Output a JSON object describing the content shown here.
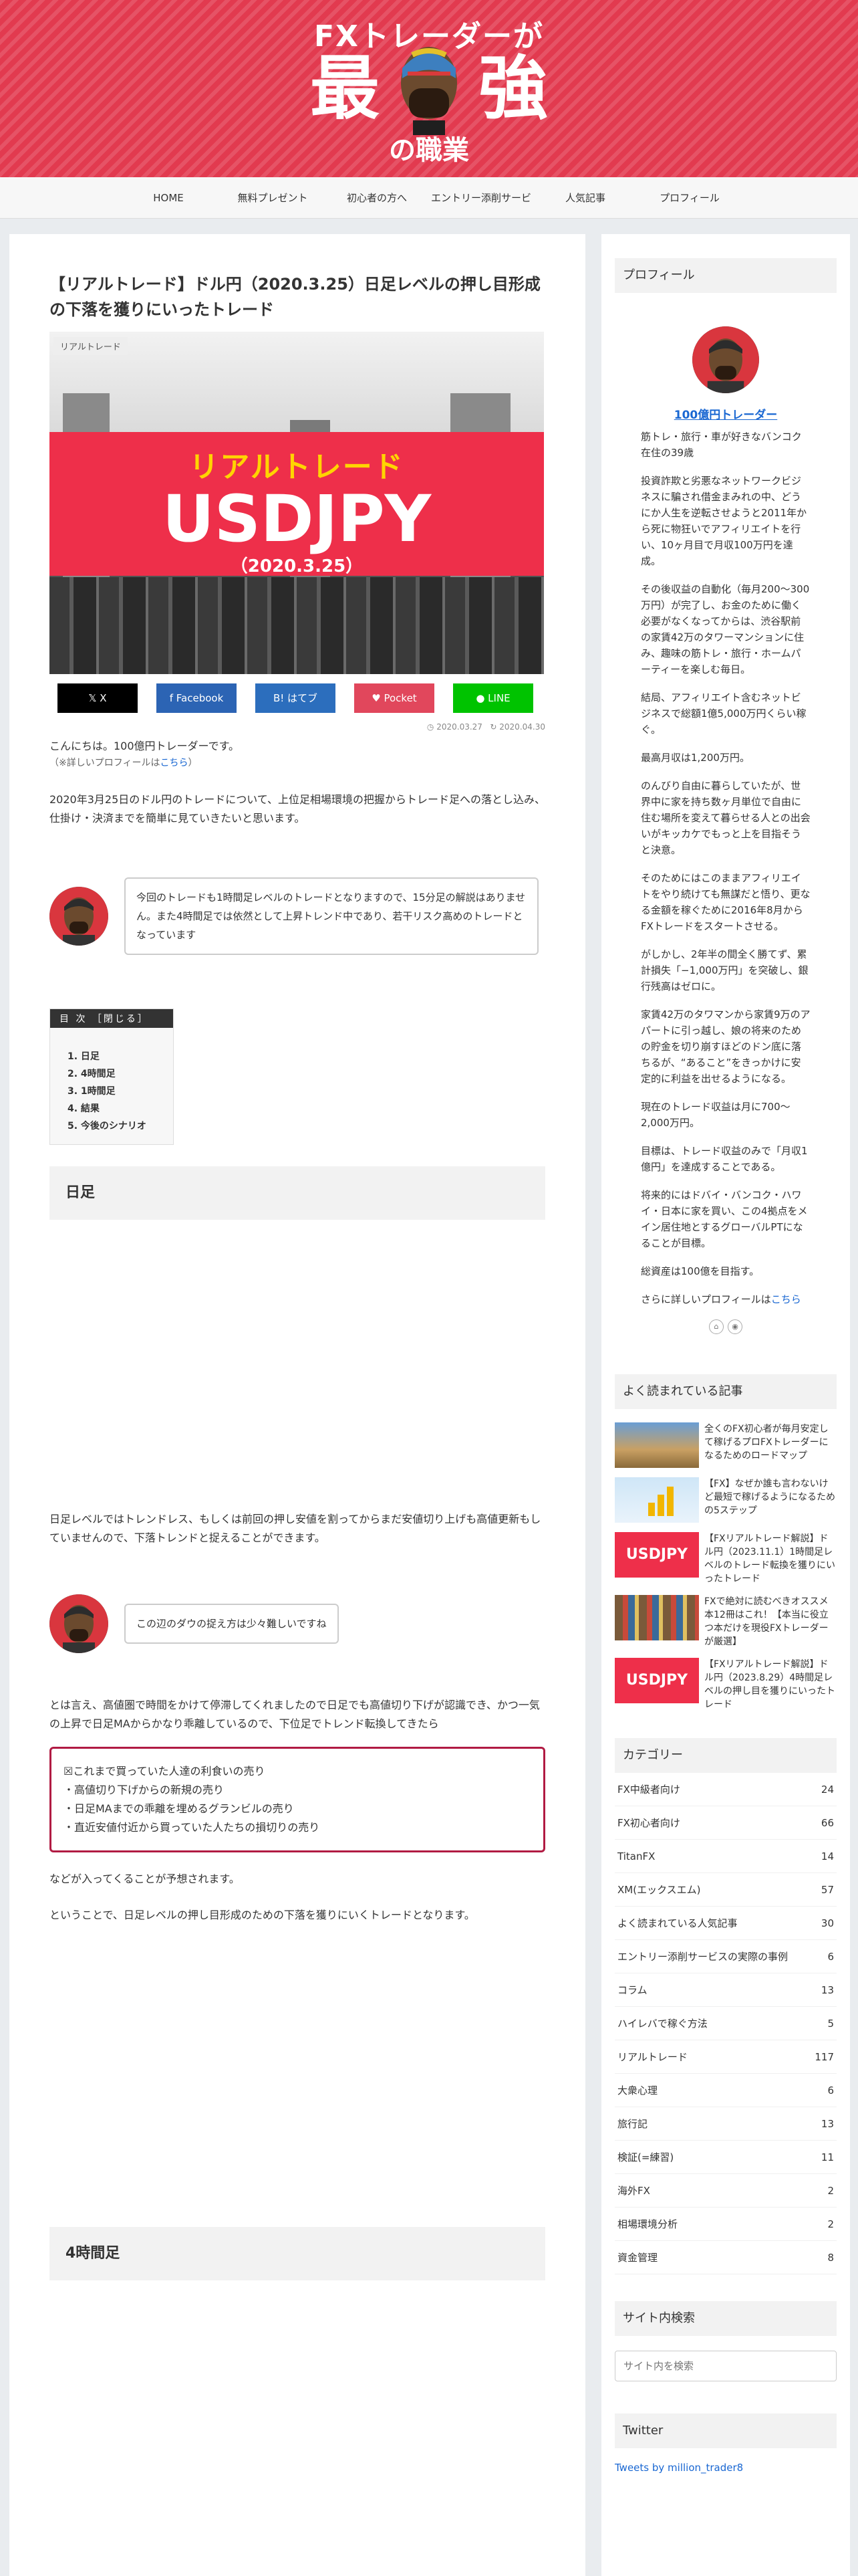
{
  "header": {
    "logo_top": "FXトレーダーが",
    "logo_left": "最",
    "logo_right": "強",
    "logo_bottom": "の職業"
  },
  "nav": [
    "HOME",
    "無料プレゼント",
    "初心者の方へ",
    "エントリー添削サービス",
    "人気記事",
    "プロフィール"
  ],
  "article": {
    "title": "【リアルトレード】ドル円（2020.3.25）日足レベルの押し目形成の下落を獲りにいったトレード",
    "category_label": "リアルトレード",
    "eyecatch": {
      "small": "リアルトレード",
      "big": "USDJPY",
      "date": "（2020.3.25）"
    },
    "share": [
      {
        "label": "𝕏 X",
        "color": "#000000"
      },
      {
        "label": "f Facebook",
        "color": "#2c64b4"
      },
      {
        "label": "B! はてブ",
        "color": "#2c6ebd"
      },
      {
        "label": "♥ Pocket",
        "color": "#e1475c"
      },
      {
        "label": "● LINE",
        "color": "#00c300"
      }
    ],
    "date_posted": "2020.03.27",
    "date_updated": "2020.04.30",
    "intro": "こんにちは。100億円トレーダーです。",
    "profile_note": "（※詳しいプロフィールは",
    "profile_link": "こちら",
    "profile_note_end": "）",
    "lead": "2020年3月25日のドル円のトレードについて、上位足相場環境の把握からトレード足への落とし込み、仕掛け・決済までを簡単に見ていきたいと思います。",
    "bubble1": "今回のトレードも1時間足レベルのトレードとなりますので、15分足の解説はありません。また4時間足では依然として上昇トレンド中であり、若干リスク高めのトレードとなっています",
    "toc": {
      "title": "目 次 ［閉じる］",
      "items": [
        "1. 日足",
        "2. 4時間足",
        "3. 1時間足",
        "4. 結果",
        "5. 今後のシナリオ"
      ]
    },
    "h2_1": "日足",
    "daily_text": "日足レベルではトレンドレス、もしくは前回の押し安値を割ってからまだ安値切り上げも高値更新もしていませんので、下落トレンドと捉えることができます。",
    "bubble2": "この辺のダウの捉え方は少々難しいですね",
    "para2": "とは言え、高値圏で時間をかけて停滞してくれましたので日足でも高値切り下げが認識でき、かつ一気の上昇で日足MAからかなり乖離しているので、下位足でトレンド転換してきたら",
    "alert": [
      "☒これまで買っていた人達の利食いの売り",
      "・高値切り下げからの新規の売り",
      "・日足MAまでの乖離を埋めるグランビルの売り",
      "・直近安値付近から買っていた人たちの損切りの売り"
    ],
    "para3": "などが入ってくることが予想されます。",
    "para4": "ということで、日足レベルの押し目形成のための下落を獲りにいくトレードとなります。",
    "h2_2": "4時間足"
  },
  "sidebar": {
    "profile_head": "プロフィール",
    "profile_name": "100億円トレーダー",
    "profile_paras": [
      "筋トレ・旅行・車が好きなバンコク在住の39歳",
      "投資詐欺と劣悪なネットワークビジネスに騙され借金まみれの中、どうにか人生を逆転させようと2011年から死に物狂いでアフィリエイトを行い、10ヶ月目で月収100万円を達成。",
      "その後収益の自動化（毎月200〜300万円）が完了し、お金のために働く必要がなくなってからは、渋谷駅前の家賃42万のタワーマンションに住み、趣味の筋トレ・旅行・ホームパーティーを楽しむ毎日。",
      "結局、アフィリエイト含むネットビジネスで総額1億5,000万円くらい稼ぐ。",
      "最高月収は1,200万円。",
      "のんびり自由に暮らしていたが、世界中に家を持ち数ヶ月単位で自由に住む場所を変えて暮らせる人との出会いがキッカケでもっと上を目指そうと決意。",
      "そのためにはこのままアフィリエイトをやり続けても無謀だと悟り、更なる金額を稼ぐために2016年8月からFXトレードをスタートさせる。",
      "がしかし、2年半の間全く勝てず、累計損失「−1,000万円」を突破し、銀行残高はゼロに。",
      "家賃42万のタワマンから家賃9万のアパートに引っ越し、娘の将来のための貯金を切り崩すほどのドン底に落ちるが、“あること”をきっかけに安定的に利益を出せるようになる。",
      "現在のトレード収益は月に700〜2,000万円。",
      "目標は、トレード収益のみで「月収1億円」を達成することである。",
      "将来的にはドバイ・バンコク・ハワイ・日本に家を買い、この4拠点をメイン居住地とするグローバルPTになることが目標。",
      "総資産は100億を目指す。"
    ],
    "profile_more": "さらに詳しいプロフィールは",
    "profile_more_link": "こちら",
    "popular_head": "よく読まれている記事",
    "popular": [
      "全くのFX初心者が毎月安定して稼げるプロFXトレーダーになるためのロードマップ",
      "【FX】なぜか誰も言わないけど最短で稼げるようになるための5ステップ",
      "【FXリアルトレード解説】ドル円（2023.11.1）1時間足レベルのトレード転換を獲りにいったトレード",
      "FXで絶対に読むべきオススメ本12冊はこれ！【本当に役立つ本だけを現役FXトレーダーが厳選】",
      "【FXリアルトレード解説】ドル円（2023.8.29）4時間足レベルの押し目を獲りにいったトレード"
    ],
    "popular_thumb": "USDJPY",
    "category_head": "カテゴリー",
    "categories": [
      {
        "name": "FX中級者向け",
        "count": "24"
      },
      {
        "name": "FX初心者向け",
        "count": "66"
      },
      {
        "name": "TitanFX",
        "count": "14"
      },
      {
        "name": "XM(エックスエム)",
        "count": "57"
      },
      {
        "name": "よく読まれている人気記事",
        "count": "30"
      },
      {
        "name": "エントリー添削サービスの実際の事例",
        "count": "6"
      },
      {
        "name": "コラム",
        "count": "13"
      },
      {
        "name": "ハイレバで稼ぐ方法",
        "count": "5"
      },
      {
        "name": "リアルトレード",
        "count": "117"
      },
      {
        "name": "大衆心理",
        "count": "6"
      },
      {
        "name": "旅行記",
        "count": "13"
      },
      {
        "name": "検証(=練習)",
        "count": "11"
      },
      {
        "name": "海外FX",
        "count": "2"
      },
      {
        "name": "相場環境分析",
        "count": "2"
      },
      {
        "name": "資金管理",
        "count": "8"
      }
    ],
    "search_head": "サイト内検索",
    "search_placeholder": "サイト内を検索",
    "twitter_head": "Twitter",
    "twitter_link": "Tweets by million_trader8"
  }
}
